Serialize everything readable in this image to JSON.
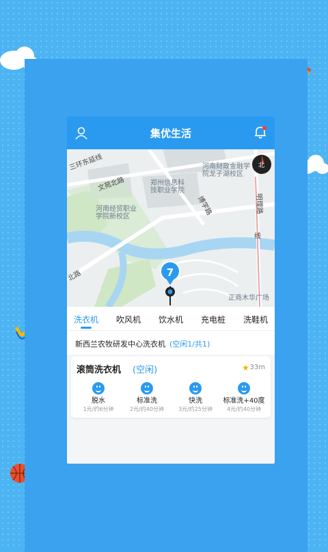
{
  "app": {
    "title": "集优生活"
  },
  "map": {
    "labels": {
      "third_ring": "三环东延线",
      "wenyuan_north": "文苑北路",
      "zhengzhou_it": "郑州信息科\n技职业学院",
      "henan_finance": "河南财政金融学\n院龙子湖校区",
      "henan_trade": "河南经贸职业\n学院新校区",
      "boxue_road": "博学路",
      "mingli_road": "明理路",
      "north_road": "北路",
      "zhengshang": "正商木华广场",
      "line": "线",
      "compass": "北"
    },
    "cluster_count": "7"
  },
  "tabs": [
    {
      "label": "洗衣机",
      "active": true
    },
    {
      "label": "吹风机",
      "active": false
    },
    {
      "label": "饮水机",
      "active": false
    },
    {
      "label": "充电桩",
      "active": false
    },
    {
      "label": "洗鞋机",
      "active": false
    }
  ],
  "location": {
    "name": "新西兰农牧研发中心洗衣机",
    "status": "(空闲1/共1)"
  },
  "machine": {
    "name": "滚筒洗衣机",
    "status": "(空闲)",
    "distance": "33m",
    "modes": [
      {
        "label": "脱水",
        "price": "1元/约6分钟"
      },
      {
        "label": "标准洗",
        "price": "2元/约40分钟"
      },
      {
        "label": "快洗",
        "price": "3元/约25分钟"
      },
      {
        "label": "标准洗+40度",
        "price": "4元/约40分钟"
      }
    ]
  },
  "colors": {
    "primary": "#2a9af0",
    "background": "#4cb4f2",
    "frame": "#3aa2ee"
  }
}
